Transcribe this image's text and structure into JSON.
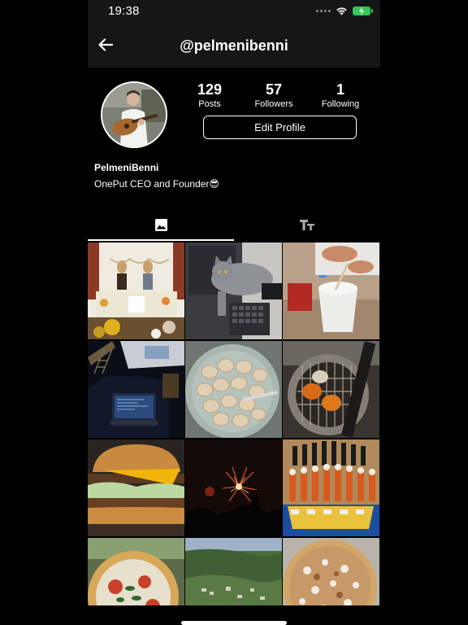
{
  "status_bar": {
    "time": "19:38",
    "icons": [
      "cellular-dots-icon",
      "wifi-icon",
      "battery-charging-icon"
    ]
  },
  "header": {
    "title": "@pelmenibenni",
    "back_icon": "arrow-left-icon"
  },
  "profile": {
    "display_name": "PelmeniBenni",
    "bio": "OnePut CEO and Founder😎",
    "stats": [
      {
        "value": "129",
        "label": "Posts"
      },
      {
        "value": "57",
        "label": "Followers"
      },
      {
        "value": "1",
        "label": "Following"
      }
    ],
    "edit_button_label": "Edit Profile"
  },
  "tabs": [
    {
      "icon": "image-icon",
      "active": true
    },
    {
      "icon": "text-format-icon",
      "active": false
    }
  ],
  "posts": [
    "festival-altar-photo",
    "cat-on-desk-photo",
    "ice-cream-cup-photo",
    "outdoor-screen-laptop-photo",
    "dumplings-bowl-photo",
    "grill-cooking-photo",
    "cheeseburger-photo",
    "fireworks-photo",
    "chess-set-photo",
    "margherita-pizza-photo",
    "coastal-aerial-photo",
    "loaded-pizza-photo"
  ]
}
